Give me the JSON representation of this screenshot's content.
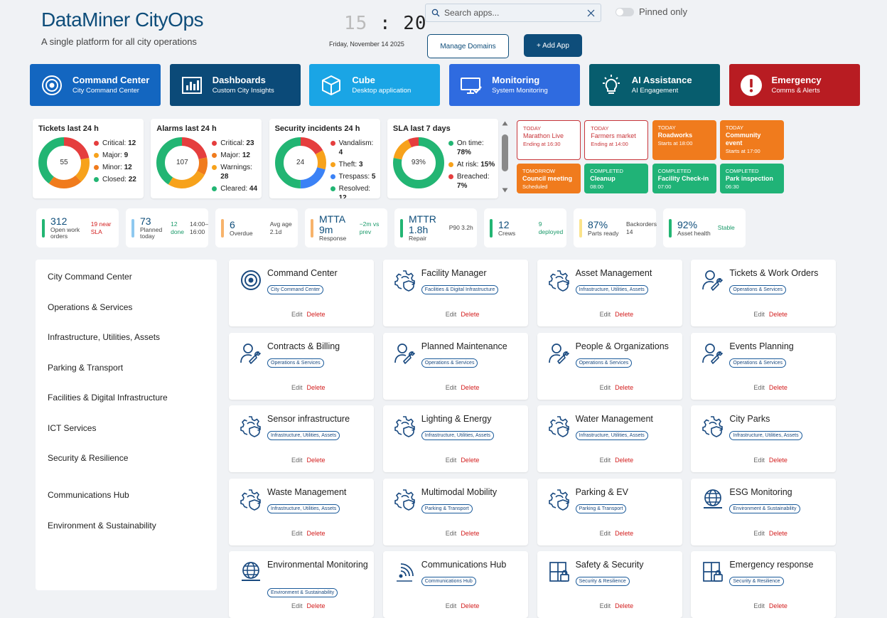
{
  "header": {
    "title": "DataMiner CityOps",
    "tagline": "A single platform for all city operations",
    "clock_hour": "15",
    "clock_min": "20",
    "date": "Friday, November 14 2025",
    "search_placeholder": "Search apps...",
    "pinned_label": "Pinned only",
    "manage_label": "Manage Domains",
    "add_label": "+ Add App"
  },
  "tiles": [
    {
      "title": "Command Center",
      "sub": "City Command Center",
      "color": "#1366c0",
      "icon": "target-icon"
    },
    {
      "title": "Dashboards",
      "sub": "Custom City Insights",
      "color": "#0b4a78",
      "icon": "bar-chart-icon"
    },
    {
      "title": "Cube",
      "sub": "Desktop application",
      "color": "#1aa5e5",
      "icon": "cube-icon"
    },
    {
      "title": "Monitoring",
      "sub": "System Monitoring",
      "color": "#2f6be0",
      "icon": "monitor-icon"
    },
    {
      "title": "AI Assistance",
      "sub": "AI Engagement",
      "color": "#075d6e",
      "icon": "lightbulb-icon"
    },
    {
      "title": "Emergency",
      "sub": "Comms & Alerts",
      "color": "#b81c22",
      "icon": "alert-icon"
    }
  ],
  "kpis": [
    {
      "title": "Tickets last 24 h",
      "center": "55",
      "segments": [
        12,
        9,
        12,
        22
      ],
      "colors": [
        "#e53e3e",
        "#f7a21b",
        "#f07b1d",
        "#22b573"
      ],
      "legend": [
        [
          "Critical:",
          "12"
        ],
        [
          "Major:",
          "9"
        ],
        [
          "Minor:",
          "12"
        ],
        [
          "Closed:",
          "22"
        ]
      ]
    },
    {
      "title": "Alarms last 24 h",
      "center": "107",
      "segments": [
        23,
        12,
        28,
        44
      ],
      "colors": [
        "#e53e3e",
        "#f07b1d",
        "#f7a21b",
        "#22b573"
      ],
      "legend": [
        [
          "Critical:",
          "23"
        ],
        [
          "Major:",
          "12"
        ],
        [
          "Warnings:",
          "28"
        ],
        [
          "Cleared:",
          "44"
        ]
      ]
    },
    {
      "title": "Security incidents 24 h",
      "center": "24",
      "segments": [
        4,
        3,
        5,
        12
      ],
      "colors": [
        "#e53e3e",
        "#f7a21b",
        "#3b82f6",
        "#22b573"
      ],
      "legend": [
        [
          "Vandalism:",
          "4"
        ],
        [
          "Theft:",
          "3"
        ],
        [
          "Trespass:",
          "5"
        ],
        [
          "Resolved:",
          "12"
        ]
      ]
    },
    {
      "title": "SLA last 7 days",
      "center": "93%",
      "segments": [
        78,
        15,
        7
      ],
      "colors": [
        "#22b573",
        "#f7a21b",
        "#e53e3e"
      ],
      "legend": [
        [
          "On time:",
          "78%"
        ],
        [
          "At risk:",
          "15%"
        ],
        [
          "Breached:",
          "7%"
        ]
      ]
    }
  ],
  "events": [
    {
      "when": "TODAY",
      "name": "Marathon Live",
      "detail": "Ending at 16:30",
      "style": "outline"
    },
    {
      "when": "TODAY",
      "name": "Farmers market",
      "detail": "Ending at 14:00",
      "style": "outline"
    },
    {
      "when": "TODAY",
      "name": "Roadworks",
      "detail": "Starts at 18:00",
      "style": "orange"
    },
    {
      "when": "TODAY",
      "name": "Community event",
      "detail": "Starts at 17:00",
      "style": "orange"
    },
    {
      "when": "TOMORROW",
      "name": "Council meeting",
      "detail": "Scheduled",
      "style": "orange"
    },
    {
      "when": "COMPLETED",
      "name": "Cleanup",
      "detail": "08:00",
      "style": "green"
    },
    {
      "when": "COMPLETED",
      "name": "Facility Check-in",
      "detail": "07:00",
      "style": "green"
    },
    {
      "when": "COMPLETED",
      "name": "Park inspection",
      "detail": "06:30",
      "style": "green"
    }
  ],
  "stats": [
    {
      "value": "312",
      "label": "Open work orders",
      "extra": "19 near SLA",
      "bar": "#22b573",
      "xcolor": "#d32020"
    },
    {
      "value": "73",
      "label": "Planned today",
      "extra": "12 done",
      "extra2": "14:00–16:00",
      "bar": "#8ec9f0",
      "xcolor": "#1a9a6a"
    },
    {
      "value": "6",
      "label": "Overdue",
      "extra": "Avg age 2.1d",
      "bar": "#f7b36b",
      "xcolor": "#444"
    },
    {
      "value": "MTTA 9m",
      "label": "Response",
      "extra": "−2m vs prev",
      "bar": "#f7b36b",
      "xcolor": "#1a9a6a"
    },
    {
      "value": "MTTR 1.8h",
      "label": "Repair",
      "extra": "P90 3.2h",
      "bar": "#22b573",
      "xcolor": "#444"
    },
    {
      "value": "12",
      "label": "Crews",
      "extra": "9 deployed",
      "bar": "#22b573",
      "xcolor": "#1a9a6a"
    },
    {
      "value": "87%",
      "label": "Parts ready",
      "extra": "Backorders 14",
      "bar": "#fbe38a",
      "xcolor": "#444"
    },
    {
      "value": "92%",
      "label": "Asset health",
      "extra": "Stable",
      "bar": "#22b573",
      "xcolor": "#1a9a6a"
    }
  ],
  "sidebar": [
    "City Command Center",
    "Operations & Services",
    "Infrastructure, Utilities, Assets",
    "Parking & Transport",
    "Facilities & Digital Infrastructure",
    "ICT Services",
    "Security & Resilience",
    "Communications Hub",
    "Environment & Sustainability"
  ],
  "app_actions": {
    "edit": "Edit",
    "delete": "Delete"
  },
  "apps": [
    {
      "name": "Command Center",
      "tag": "City Command Center",
      "icon": "target-icon"
    },
    {
      "name": "Facility Manager",
      "tag": "Facilities & Digital Infrastructure",
      "icon": "gear-shield-icon"
    },
    {
      "name": "Asset Management",
      "tag": "Infrastructure, Utilities, Assets",
      "icon": "gear-shield-icon"
    },
    {
      "name": "Tickets & Work Orders",
      "tag": "Operations & Services",
      "icon": "person-wrench-icon"
    },
    {
      "name": "Contracts & Billing",
      "tag": "Operations & Services",
      "icon": "person-wrench-icon"
    },
    {
      "name": "Planned Maintenance",
      "tag": "Operations & Services",
      "icon": "person-wrench-icon"
    },
    {
      "name": "People & Organizations",
      "tag": "Operations & Services",
      "icon": "person-wrench-icon"
    },
    {
      "name": "Events Planning",
      "tag": "Operations & Services",
      "icon": "person-wrench-icon"
    },
    {
      "name": "Sensor infrastructure",
      "tag": "Infrastructure, Utilities, Assets",
      "icon": "gear-shield-icon"
    },
    {
      "name": "Lighting & Energy",
      "tag": "Infrastructure, Utilities, Assets",
      "icon": "gear-shield-icon"
    },
    {
      "name": "Water Management",
      "tag": "Infrastructure, Utilities, Assets",
      "icon": "gear-shield-icon"
    },
    {
      "name": "City Parks",
      "tag": "Infrastructure, Utilities, Assets",
      "icon": "gear-shield-icon"
    },
    {
      "name": "Waste Management",
      "tag": "Infrastructure, Utilities, Assets",
      "icon": "gear-shield-icon"
    },
    {
      "name": "Multimodal Mobility",
      "tag": "Parking & Transport",
      "icon": "gear-shield-icon"
    },
    {
      "name": "Parking & EV",
      "tag": "Parking & Transport",
      "icon": "gear-shield-icon"
    },
    {
      "name": "ESG Monitoring",
      "tag": "Environment & Sustainability",
      "icon": "globe-icon"
    },
    {
      "name": "Environmental Monitoring",
      "tag": "Environment & Sustainability",
      "icon": "globe-icon"
    },
    {
      "name": "Communications Hub",
      "tag": "Communications Hub",
      "icon": "signal-icon"
    },
    {
      "name": "Safety & Security",
      "tag": "Security & Resilience",
      "icon": "building-lock-icon"
    },
    {
      "name": "Emergency response",
      "tag": "Security & Resilience",
      "icon": "building-lock-icon"
    }
  ]
}
